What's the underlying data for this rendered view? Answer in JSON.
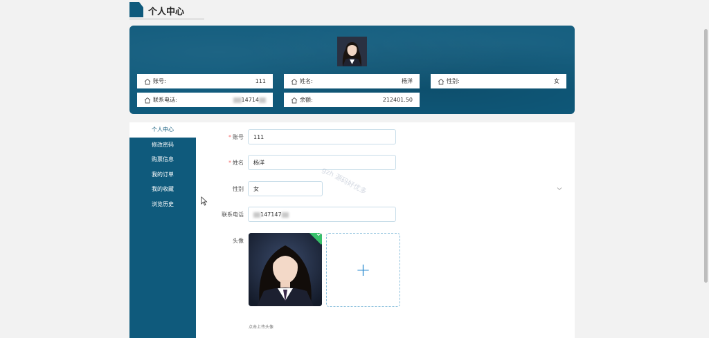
{
  "page": {
    "title": "个人中心"
  },
  "header": {
    "info": [
      {
        "label": "账号:",
        "value": "111"
      },
      {
        "label": "姓名:",
        "value": "杨洋"
      },
      {
        "label": "性别:",
        "value": "女"
      },
      {
        "label": "联系电话:",
        "value": "14714"
      },
      {
        "label": "余额:",
        "value": "212401.50"
      }
    ]
  },
  "menu": {
    "items": [
      {
        "label": "个人中心"
      },
      {
        "label": "修改密码"
      },
      {
        "label": "购票信息"
      },
      {
        "label": "我的订单"
      },
      {
        "label": "我的收藏"
      },
      {
        "label": "浏览历史"
      }
    ]
  },
  "form": {
    "account": {
      "label": "账号",
      "value": "111"
    },
    "name": {
      "label": "姓名",
      "value": "杨洋"
    },
    "gender": {
      "label": "性别",
      "value": "女"
    },
    "phone": {
      "label": "联系电话",
      "value": "147147"
    },
    "avatar": {
      "label": "头像",
      "hint": "点击上传头像"
    },
    "required_mark": "*",
    "upload_plus": "+"
  },
  "watermark": "gzh 源码好优多",
  "colors": {
    "primary": "#0f5a7c",
    "required": "#f56c6c",
    "success": "#38c16b",
    "accent": "#2b8bd0"
  }
}
